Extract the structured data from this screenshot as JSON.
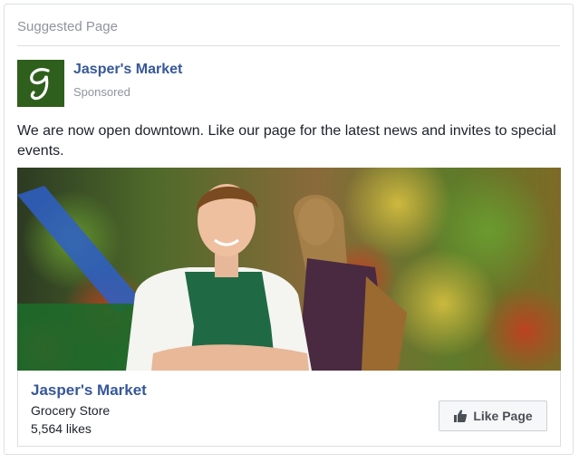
{
  "header": {
    "title": "Suggested Page"
  },
  "post": {
    "page_name": "Jasper's Market",
    "avatar_letter": "J",
    "sponsored_label": "Sponsored",
    "text": "We are now open downtown. Like our page for the latest news and invites to special events.",
    "photo_icon": "grocery-store-photo"
  },
  "attachment": {
    "name": "Jasper's Market",
    "category": "Grocery Store",
    "likes": "5,564 likes",
    "like_button_label": "Like Page",
    "like_icon": "thumbs-up-icon"
  },
  "colors": {
    "link": "#365899",
    "muted": "#90949c",
    "avatar_bg": "#2f5f1c",
    "button_bg": "#f6f7f9"
  }
}
